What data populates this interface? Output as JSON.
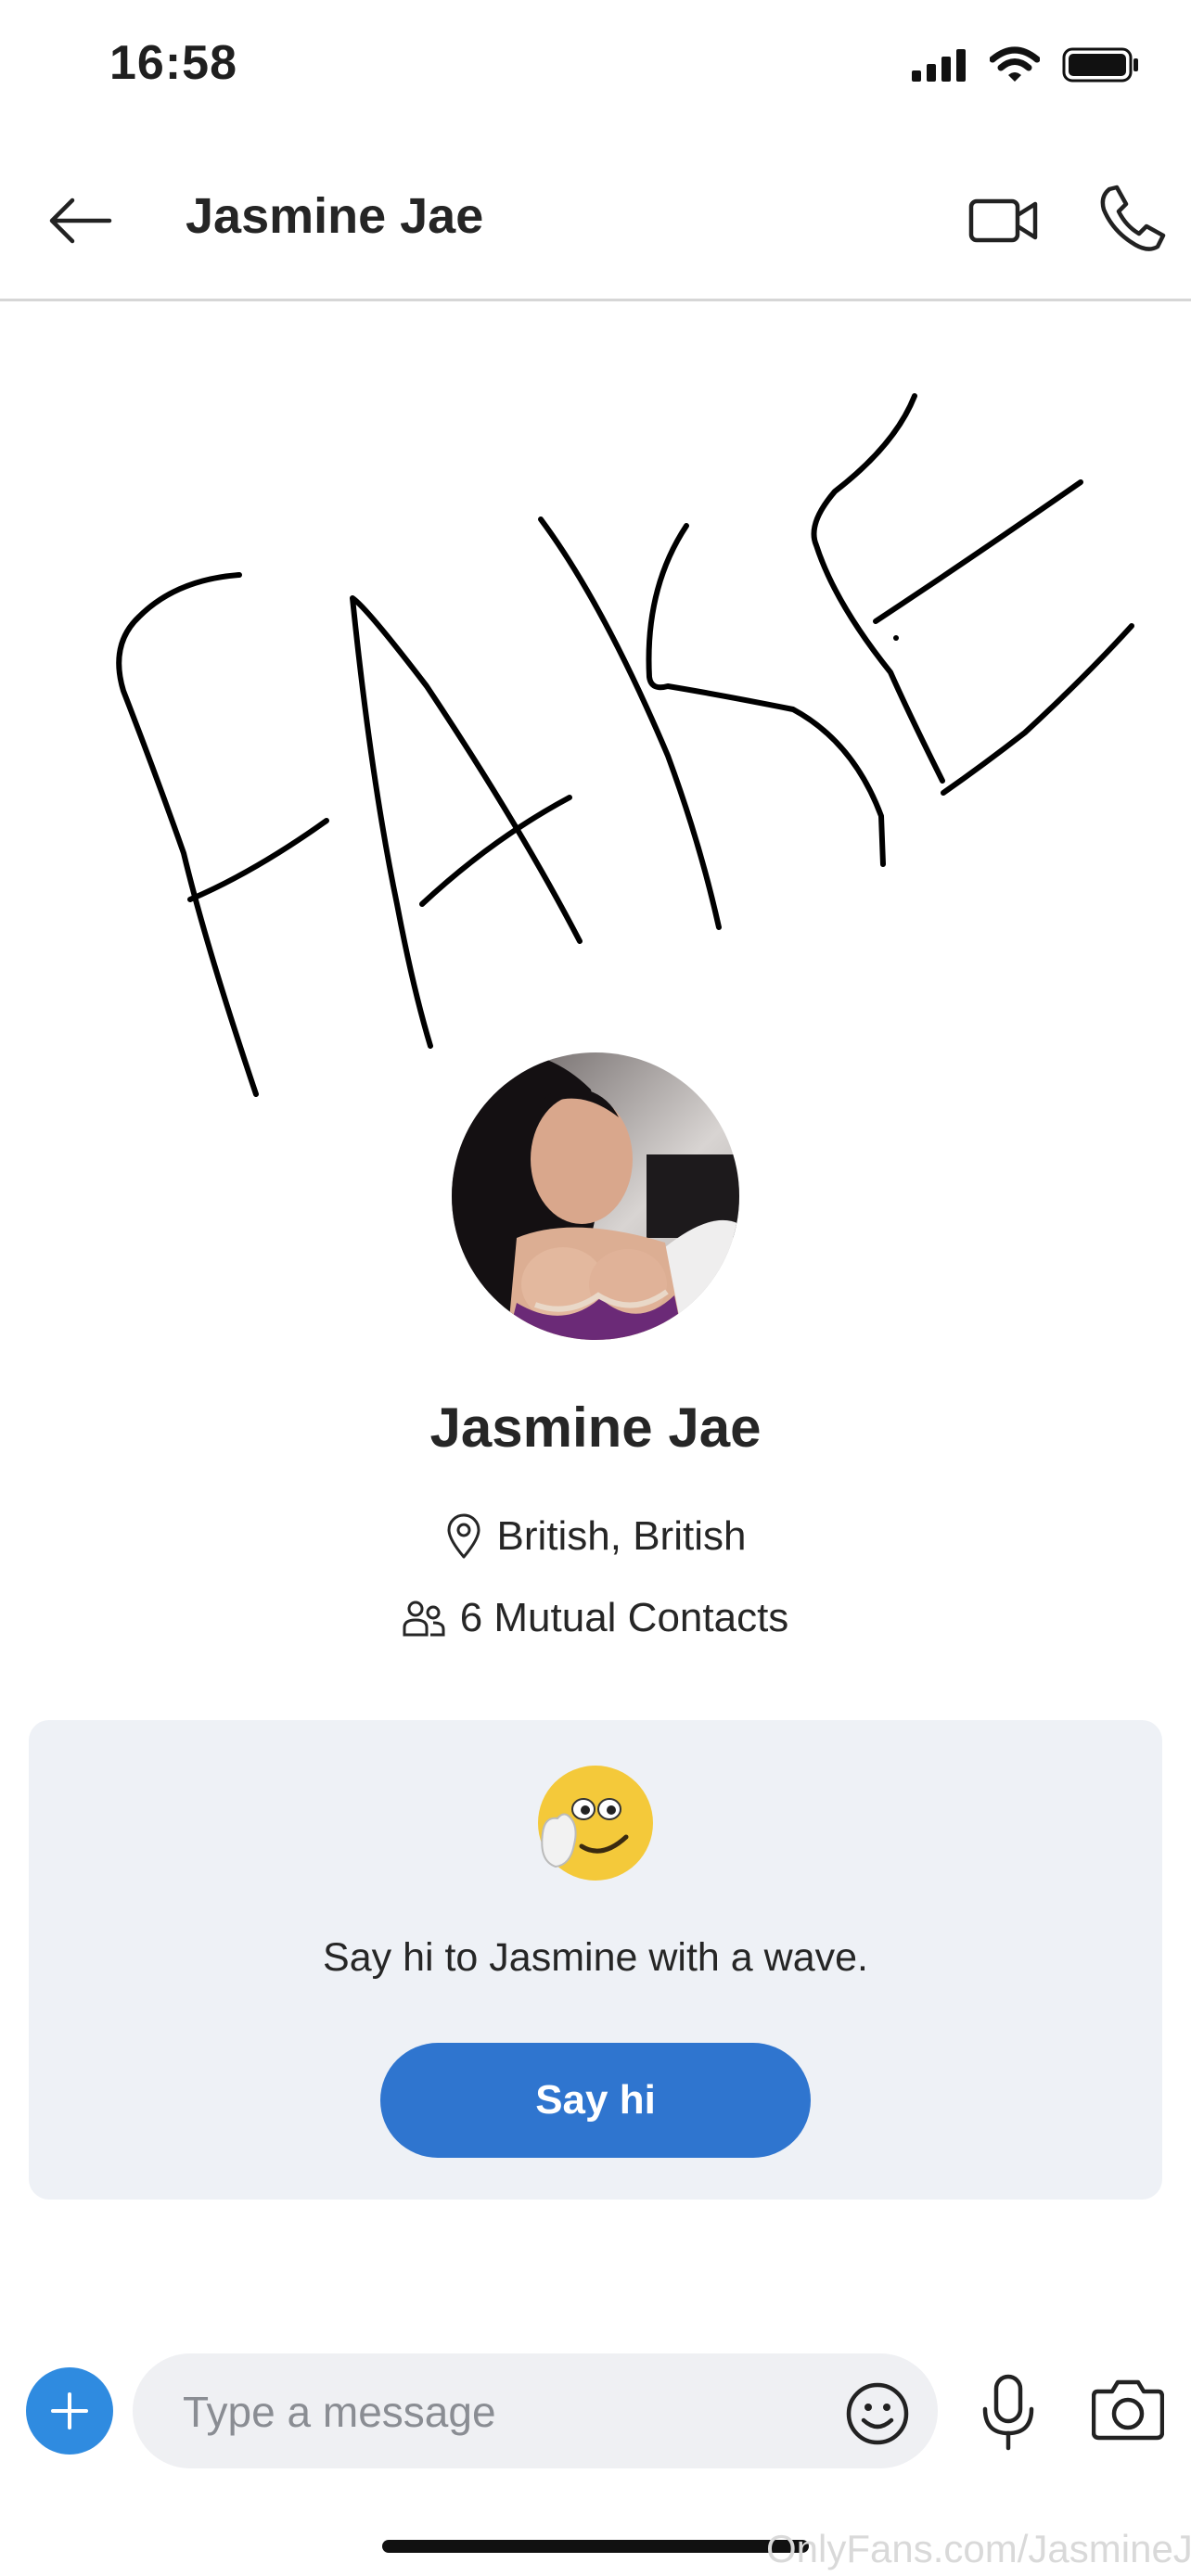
{
  "status_bar": {
    "time": "16:58"
  },
  "header": {
    "title": "Jasmine Jae"
  },
  "profile": {
    "name": "Jasmine Jae",
    "location": "British, British",
    "mutual_contacts": "6 Mutual Contacts"
  },
  "wave_card": {
    "text": "Say hi to Jasmine with a wave.",
    "button_label": "Say hi"
  },
  "composer": {
    "placeholder": "Type a message"
  },
  "watermark": "OnlyFans.com/JasmineJae",
  "scribble_text": "FAKE",
  "colors": {
    "accent": "#2f75cf",
    "add_button": "#2f8be0",
    "card_bg": "#eef1f6"
  }
}
